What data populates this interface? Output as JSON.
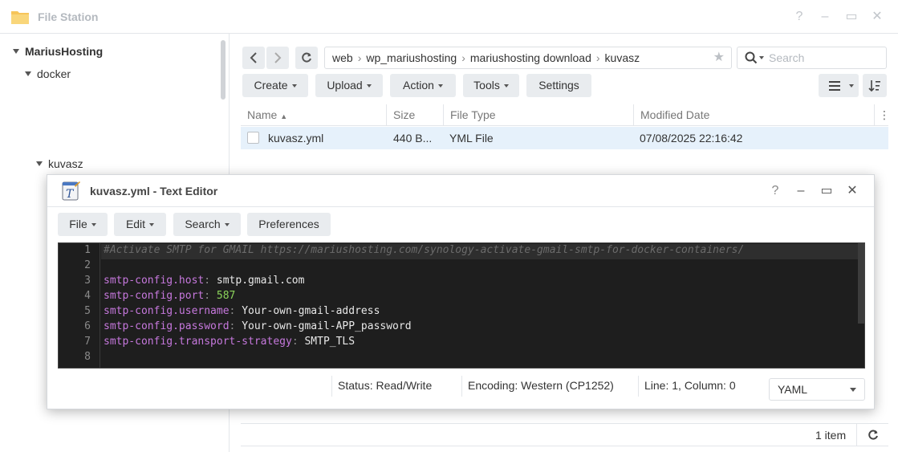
{
  "window": {
    "title": "File Station",
    "controls": [
      "?",
      "–",
      "▭",
      "✕"
    ]
  },
  "sidebar": {
    "items": [
      {
        "label": "MariusHosting"
      },
      {
        "label": "docker"
      },
      {
        "label": "kuvasz"
      }
    ]
  },
  "path": {
    "segments": [
      "web",
      "wp_mariushosting",
      "mariushosting download",
      "kuvasz"
    ],
    "separator": "›"
  },
  "search": {
    "placeholder": "Search"
  },
  "toolbar": {
    "create": "Create",
    "upload": "Upload",
    "action": "Action",
    "tools": "Tools",
    "settings": "Settings"
  },
  "file_list": {
    "columns": [
      "Name",
      "Size",
      "File Type",
      "Modified Date"
    ],
    "sort_indicator": "▲",
    "rows": [
      {
        "name": "kuvasz.yml",
        "size": "440 B...",
        "type": "YML File",
        "modified": "07/08/2025 22:16:42"
      }
    ],
    "item_count": "1 item"
  },
  "editor": {
    "title": "kuvasz.yml - Text Editor",
    "controls": [
      "?",
      "–",
      "▭",
      "✕"
    ],
    "menu": {
      "file": "File",
      "edit": "Edit",
      "search": "Search",
      "preferences": "Preferences"
    },
    "line_numbers": [
      "1",
      "2",
      "3",
      "4",
      "5",
      "6",
      "7",
      "8"
    ],
    "lines": [
      {
        "comment": "#Activate SMTP for GMAIL https://mariushosting.com/synology-activate-gmail-smtp-for-docker-containers/"
      },
      {},
      {
        "key": "smtp-config.host",
        "colon": ":",
        "value": "smtp.gmail.com"
      },
      {
        "key": "smtp-config.port",
        "colon": ":",
        "value": "587"
      },
      {
        "key": "smtp-config.username",
        "colon": ":",
        "value": "Your-own-gmail-address"
      },
      {
        "key": "smtp-config.password",
        "colon": ":",
        "value": "Your-own-gmail-APP_password"
      },
      {
        "key": "smtp-config.transport-strategy",
        "colon": ":",
        "value": "SMTP_TLS"
      },
      {}
    ],
    "status": {
      "status": "Status: Read/Write",
      "encoding": "Encoding: Western (CP1252)",
      "position": "Line: 1, Column: 0",
      "mode": "YAML"
    }
  },
  "colors": {
    "selected_row": "#e6f1fb",
    "editor_bg": "#1e1e1e",
    "syntax_key": "#c678dd",
    "syntax_number": "#8bd35b",
    "syntax_comment": "#6b6b6b"
  }
}
